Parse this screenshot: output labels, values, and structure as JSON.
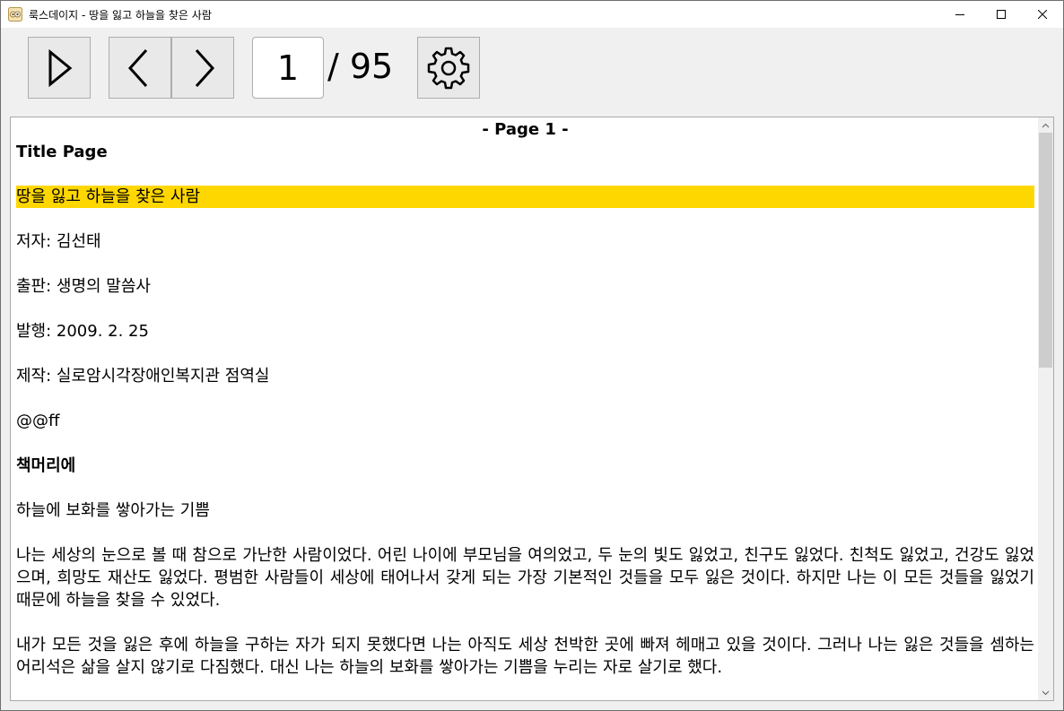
{
  "window": {
    "title": "룩스데이지 - 땅을 잃고 하늘을 찾은 사람"
  },
  "toolbar": {
    "play_icon": "play-icon",
    "prev_icon": "chevron-left-icon",
    "next_icon": "chevron-right-icon",
    "current_page": "1",
    "total_pages": "/ 95",
    "settings_icon": "gear-icon"
  },
  "content": {
    "page_header": "- Page 1 -",
    "paragraphs": {
      "p0": "Title Page",
      "p1": "땅을 잃고 하늘을 찾은 사람",
      "p2": "저자: 김선태",
      "p3": "출판: 생명의 말씀사",
      "p4": "발행: 2009. 2. 25",
      "p5": "제작: 실로암시각장애인복지관 점역실",
      "p6": "@@ff",
      "p7": "책머리에",
      "p8": "하늘에 보화를 쌓아가는 기쁨",
      "p9": "나는 세상의 눈으로 볼 때 참으로 가난한 사람이었다. 어린 나이에 부모님을 여의었고, 두 눈의 빛도 잃었고, 친구도 잃었다. 친척도 잃었고, 건강도 잃었으며, 희망도 재산도 잃었다. 평범한 사람들이 세상에 태어나서 갖게 되는 가장 기본적인 것들을 모두 잃은 것이다. 하지만 나는 이 모든 것들을 잃었기 때문에 하늘을 찾을 수 있었다.",
      "p10": "내가 모든 것을 잃은 후에 하늘을 구하는 자가 되지 못했다면 나는 아직도 세상 천박한 곳에 빠져 헤매고 있을 것이다. 그러나 나는 잃은 것들을 셈하는 어리석은 삶을 살지 않기로 다짐했다. 대신 나는 하늘의 보화를 쌓아가는 기쁨을 누리는 자로 살기로 했다."
    },
    "highlight_color": "#ffd700"
  }
}
